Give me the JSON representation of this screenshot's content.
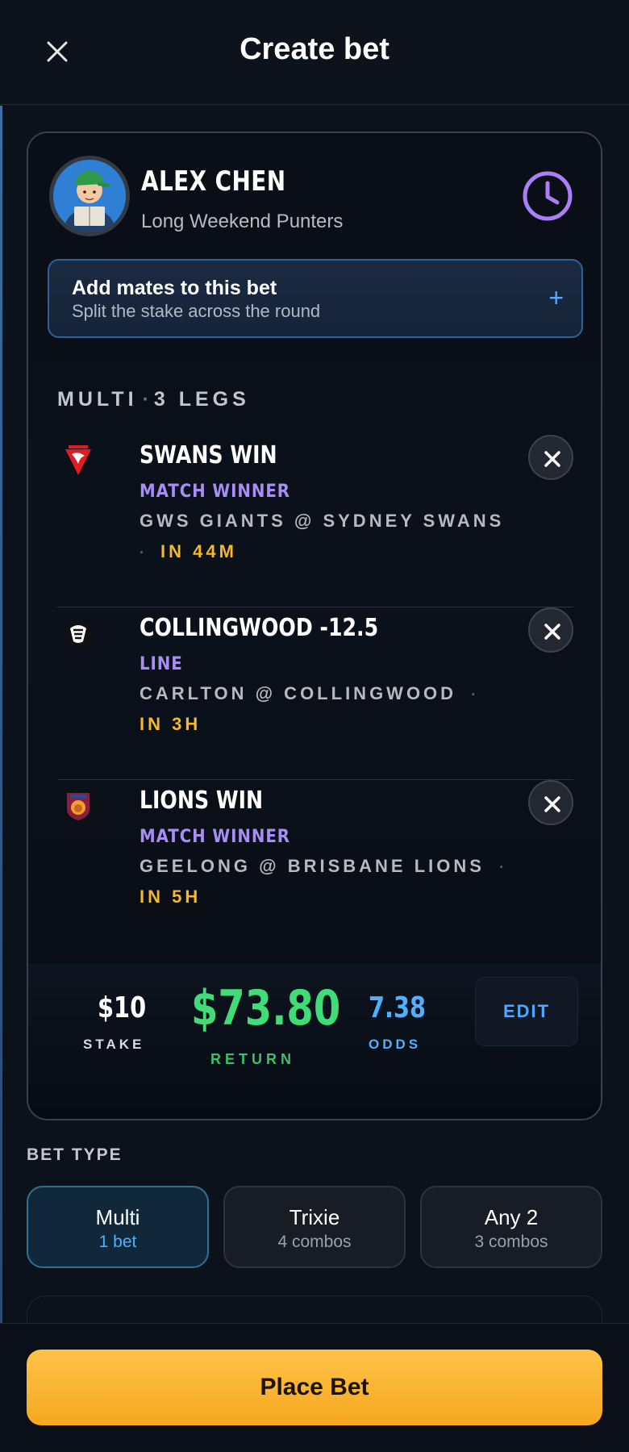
{
  "header": {
    "title": "Create bet",
    "close_icon": "close-icon"
  },
  "user": {
    "name": "ALEX CHEN",
    "group": "Long Weekend Punters",
    "history_icon": "clock-icon"
  },
  "add_mates": {
    "title": "Add mates to this bet",
    "subtitle": "Split the stake across the round",
    "icon": "plus-icon"
  },
  "multi": {
    "type": "MULTI",
    "separator": "·",
    "legs_count": "3 LEGS"
  },
  "legs": [
    {
      "title": "SWANS WIN",
      "market": "MATCH WINNER",
      "match": "GWS GIANTS @ SYDNEY SWANS",
      "time": "IN 44M",
      "logo": "sydney-swans-logo"
    },
    {
      "title": "COLLINGWOOD -12.5",
      "market": "LINE",
      "match": "CARLTON @ COLLINGWOOD",
      "time": "IN 3H",
      "logo": "collingwood-logo"
    },
    {
      "title": "LIONS WIN",
      "market": "MATCH WINNER",
      "match": "GEELONG @ BRISBANE LIONS",
      "time": "IN 5H",
      "logo": "brisbane-lions-logo"
    }
  ],
  "summary": {
    "stake": "$10",
    "stake_label": "STAKE",
    "return": "$73.80",
    "return_label": "RETURN",
    "odds": "7.38",
    "odds_label": "ODDS",
    "edit_label": "EDIT"
  },
  "bet_type": {
    "label": "BET TYPE",
    "options": [
      {
        "name": "Multi",
        "sub": "1 bet",
        "selected": true
      },
      {
        "name": "Trixie",
        "sub": "4 combos",
        "selected": false
      },
      {
        "name": "Any 2",
        "sub": "3 combos",
        "selected": false
      }
    ]
  },
  "footer": {
    "place_bet_label": "Place Bet"
  },
  "colors": {
    "accent_yellow": "#f5b826",
    "return_green": "#3fdc77",
    "odds_blue": "#4fb0ff",
    "market_purple": "#a88df5"
  }
}
